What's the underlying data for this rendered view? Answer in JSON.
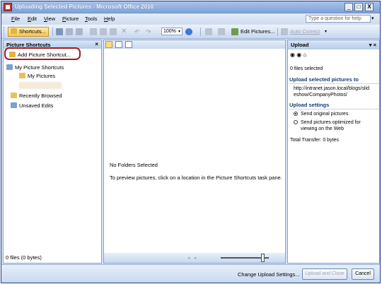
{
  "window": {
    "title": "Uploading Selected Pictures - Microsoft Office 2010",
    "minimize": "_",
    "maximize": "□",
    "close": "X"
  },
  "menu": {
    "items": [
      "File",
      "Edit",
      "View",
      "Picture",
      "Tools",
      "Help"
    ],
    "help_placeholder": "Type a question for help"
  },
  "toolbar": {
    "shortcuts_label": "Shortcuts...",
    "zoom": "100%",
    "edit_pictures_label": "Edit Pictures...",
    "auto_correct_label": "Auto Correct"
  },
  "left_pane": {
    "title": "Picture Shortcuts",
    "add_shortcut": "Add Picture Shortcut...",
    "my_picture_shortcuts": "My Picture Shortcuts",
    "my_pictures": "My Pictures",
    "recently_browsed": "Recently Browsed",
    "unsaved_edits": "Unsaved Edits",
    "status": "0 files (0 bytes)"
  },
  "center_pane": {
    "no_folders": "No Folders Selected",
    "instructions": "To preview pictures, click on a location in the Picture Shortcuts task pane."
  },
  "right_pane": {
    "title": "Upload",
    "files_selected": "0 files selected",
    "upload_to_heading": "Upload selected pictures to",
    "upload_url_line1": "http://intranet.jason.local/blogs/slid",
    "upload_url_line2": "eshow/CompanyPhotos/",
    "settings_heading": "Upload settings",
    "option_original": "Send original pictures",
    "option_optimized_line1": "Send pictures optimized for",
    "option_optimized_line2": "viewing on the Web",
    "transfer_label": "Total Transfer:",
    "transfer_value": "0 bytes"
  },
  "bottom_bar": {
    "change_settings": "Change Upload Settings...",
    "upload_close": "Upload and Close",
    "cancel": "Cancel"
  }
}
